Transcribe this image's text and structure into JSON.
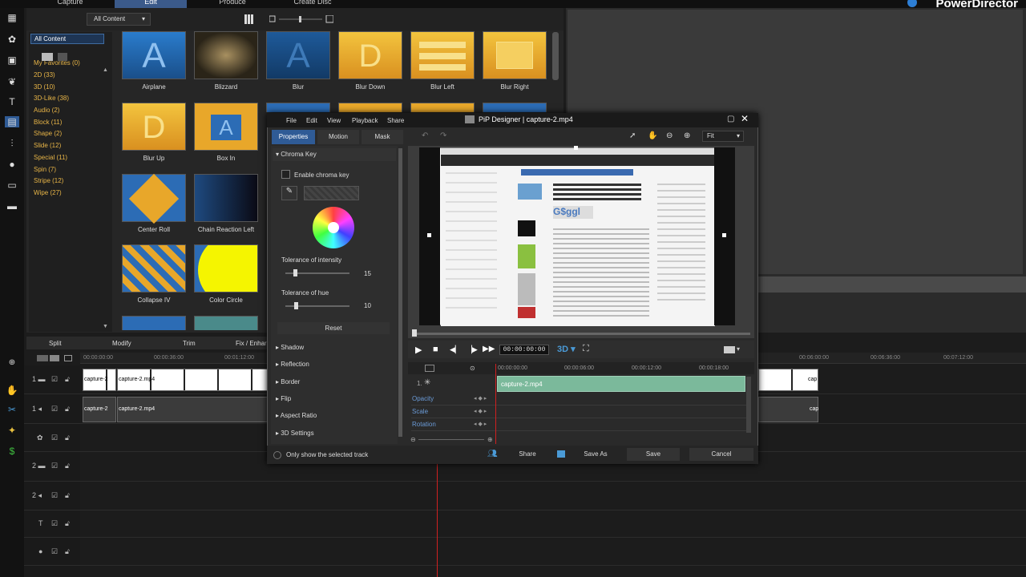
{
  "app": {
    "brand": "PowerDirector"
  },
  "topnav": {
    "tabs": [
      "Capture",
      "Edit",
      "Produce",
      "Create Disc"
    ]
  },
  "library": {
    "filter": "All Content",
    "categories": [
      "All Content",
      "My Favorites  (0)",
      "2D  (33)",
      "3D  (10)",
      "3D-Like  (38)",
      "Audio  (2)",
      "Block  (11)",
      "Shape  (2)",
      "Slide  (12)",
      "Special  (11)",
      "Spin  (7)",
      "Stripe  (12)",
      "Wipe  (27)"
    ],
    "thumbs": [
      "Airplane",
      "Blizzard",
      "Blur",
      "Blur Down",
      "Blur Left",
      "Blur Right",
      "Blur Up",
      "Box In",
      "Center Roll",
      "Chain Reaction Left",
      "Collapse IV",
      "Color Circle"
    ],
    "colors": {
      "gold": "#e8a72a",
      "blue": "#2c6cb5"
    }
  },
  "edit_tabs": [
    "Split",
    "Modify",
    "Trim",
    "Fix / Enhar"
  ],
  "timeline": {
    "ruler": [
      "00:00:00:00",
      "00:00:36:00",
      "00:01:12:00",
      "00:06:00:00",
      "00:06:36:00",
      "00:07:12:00"
    ],
    "clips": {
      "v1a": "capture-2",
      "v1b": "capture-2.mp4",
      "a1a": "capture-2",
      "a1b": "capture-2.mp4",
      "edge": "cap"
    }
  },
  "dialog": {
    "title": "PiP Designer  |  capture-2.mp4",
    "menu": [
      "File",
      "Edit",
      "View",
      "Playback",
      "Share"
    ],
    "tabs": [
      "Properties",
      "Motion",
      "Mask"
    ],
    "chroma": {
      "section": "Chroma Key",
      "enable": "Enable chroma key",
      "tol_int_label": "Tolerance of intensity",
      "tol_int_value": "15",
      "tol_hue_label": "Tolerance of hue",
      "tol_hue_value": "10",
      "reset": "Reset"
    },
    "sections": [
      "Shadow",
      "Reflection",
      "Border",
      "Flip",
      "Aspect Ratio",
      "3D Settings"
    ],
    "zoom": "Fit",
    "timecode": "00:00:00:00",
    "mode3d": "3D",
    "kf_ruler": [
      "00:00:00:00",
      "00:00:06:00",
      "00:00:12:00",
      "00:00:18:00"
    ],
    "kf_track": "1.",
    "kf_clip": "capture-2.mp4",
    "kf_rows": [
      "Opacity",
      "Scale",
      "Rotation"
    ],
    "bottom": {
      "only_track": "Only show the selected track",
      "share": "Share",
      "save_as": "Save As",
      "save": "Save",
      "cancel": "Cancel"
    }
  }
}
